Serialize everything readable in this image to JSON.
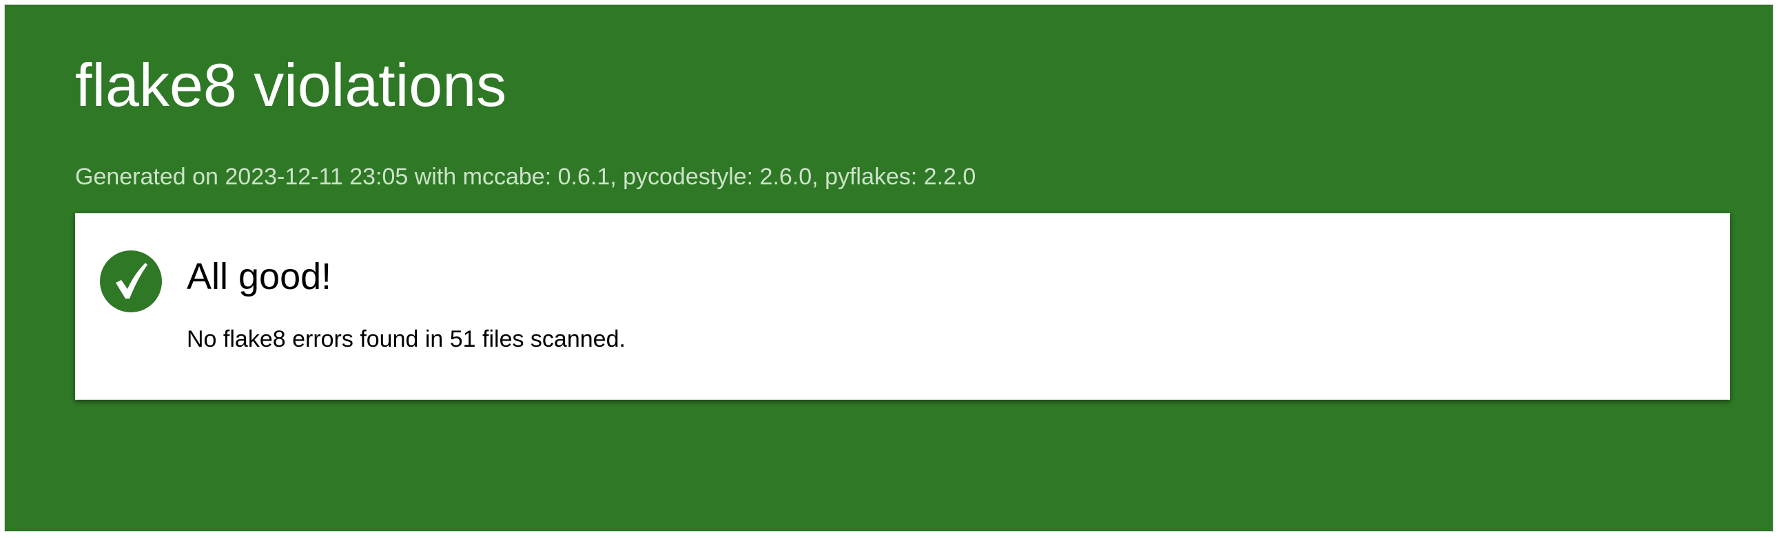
{
  "header": {
    "title": "flake8 violations",
    "generated": "Generated on 2023-12-11 23:05 with mccabe: 0.6.1, pycodestyle: 2.6.0, pyflakes: 2.2.0"
  },
  "result": {
    "icon": "checkmark-icon",
    "heading": "All good!",
    "message": "No flake8 errors found in 51 files scanned."
  },
  "colors": {
    "background_green": "#2e7826",
    "card_background": "#ffffff",
    "subtitle_text": "#cde3c8"
  }
}
